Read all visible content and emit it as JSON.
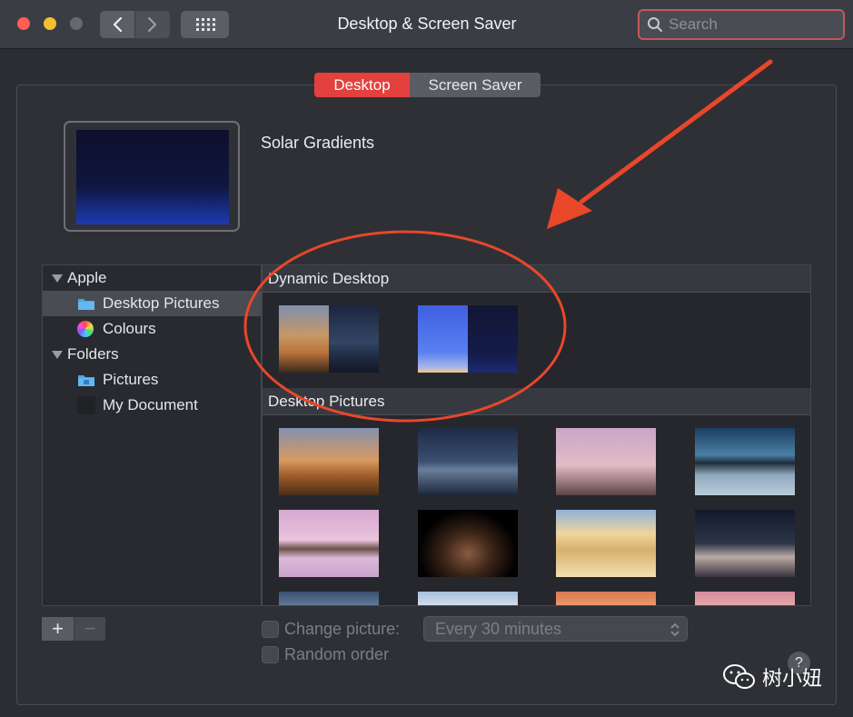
{
  "window": {
    "title": "Desktop & Screen Saver"
  },
  "search": {
    "placeholder": "Search"
  },
  "tabs": [
    {
      "label": "Desktop",
      "active": true
    },
    {
      "label": "Screen Saver",
      "active": false
    }
  ],
  "current_wallpaper": {
    "name": "Solar Gradients"
  },
  "sidebar": {
    "groups": [
      {
        "label": "Apple",
        "items": [
          {
            "label": "Desktop Pictures",
            "icon": "folder-icon",
            "selected": true
          },
          {
            "label": "Colours",
            "icon": "color-wheel-icon"
          }
        ]
      },
      {
        "label": "Folders",
        "items": [
          {
            "label": "Pictures",
            "icon": "pictures-folder-icon"
          },
          {
            "label": "My Document",
            "icon": "document-icon"
          }
        ]
      }
    ]
  },
  "gallery": {
    "sections": [
      {
        "title": "Dynamic Desktop",
        "thumbnails": [
          "mojave-dynamic",
          "solar-gradients"
        ]
      },
      {
        "title": "Desktop Pictures",
        "thumbnails": [
          "mojave-day",
          "mojave-night",
          "rock-spire-desert",
          "lake-dusk",
          "lake-rock-pink",
          "tufa-towers",
          "sand-dunes",
          "dune-night",
          "mountain-partial-1",
          "mountain-partial-2",
          "sunset-partial-1",
          "sunset-partial-2"
        ]
      }
    ]
  },
  "controls": {
    "add_label": "+",
    "remove_label": "−",
    "change_picture_label": "Change picture:",
    "change_picture_checked": false,
    "interval_value": "Every 30 minutes",
    "random_order_label": "Random order",
    "random_order_checked": false,
    "help_label": "?"
  },
  "watermark": {
    "text": "树小妞"
  },
  "colors": {
    "accent": "#e4403d",
    "annotation": "#e8472a",
    "window_bg": "#2b2d33"
  }
}
